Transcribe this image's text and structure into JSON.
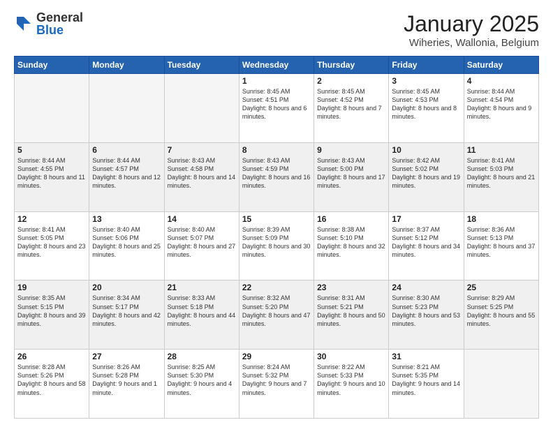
{
  "header": {
    "logo_general": "General",
    "logo_blue": "Blue",
    "title": "January 2025",
    "subtitle": "Wiheries, Wallonia, Belgium"
  },
  "days_of_week": [
    "Sunday",
    "Monday",
    "Tuesday",
    "Wednesday",
    "Thursday",
    "Friday",
    "Saturday"
  ],
  "weeks": [
    {
      "shaded": false,
      "days": [
        {
          "num": "",
          "info": ""
        },
        {
          "num": "",
          "info": ""
        },
        {
          "num": "",
          "info": ""
        },
        {
          "num": "1",
          "info": "Sunrise: 8:45 AM\nSunset: 4:51 PM\nDaylight: 8 hours and 6 minutes."
        },
        {
          "num": "2",
          "info": "Sunrise: 8:45 AM\nSunset: 4:52 PM\nDaylight: 8 hours and 7 minutes."
        },
        {
          "num": "3",
          "info": "Sunrise: 8:45 AM\nSunset: 4:53 PM\nDaylight: 8 hours and 8 minutes."
        },
        {
          "num": "4",
          "info": "Sunrise: 8:44 AM\nSunset: 4:54 PM\nDaylight: 8 hours and 9 minutes."
        }
      ]
    },
    {
      "shaded": true,
      "days": [
        {
          "num": "5",
          "info": "Sunrise: 8:44 AM\nSunset: 4:55 PM\nDaylight: 8 hours and 11 minutes."
        },
        {
          "num": "6",
          "info": "Sunrise: 8:44 AM\nSunset: 4:57 PM\nDaylight: 8 hours and 12 minutes."
        },
        {
          "num": "7",
          "info": "Sunrise: 8:43 AM\nSunset: 4:58 PM\nDaylight: 8 hours and 14 minutes."
        },
        {
          "num": "8",
          "info": "Sunrise: 8:43 AM\nSunset: 4:59 PM\nDaylight: 8 hours and 16 minutes."
        },
        {
          "num": "9",
          "info": "Sunrise: 8:43 AM\nSunset: 5:00 PM\nDaylight: 8 hours and 17 minutes."
        },
        {
          "num": "10",
          "info": "Sunrise: 8:42 AM\nSunset: 5:02 PM\nDaylight: 8 hours and 19 minutes."
        },
        {
          "num": "11",
          "info": "Sunrise: 8:41 AM\nSunset: 5:03 PM\nDaylight: 8 hours and 21 minutes."
        }
      ]
    },
    {
      "shaded": false,
      "days": [
        {
          "num": "12",
          "info": "Sunrise: 8:41 AM\nSunset: 5:05 PM\nDaylight: 8 hours and 23 minutes."
        },
        {
          "num": "13",
          "info": "Sunrise: 8:40 AM\nSunset: 5:06 PM\nDaylight: 8 hours and 25 minutes."
        },
        {
          "num": "14",
          "info": "Sunrise: 8:40 AM\nSunset: 5:07 PM\nDaylight: 8 hours and 27 minutes."
        },
        {
          "num": "15",
          "info": "Sunrise: 8:39 AM\nSunset: 5:09 PM\nDaylight: 8 hours and 30 minutes."
        },
        {
          "num": "16",
          "info": "Sunrise: 8:38 AM\nSunset: 5:10 PM\nDaylight: 8 hours and 32 minutes."
        },
        {
          "num": "17",
          "info": "Sunrise: 8:37 AM\nSunset: 5:12 PM\nDaylight: 8 hours and 34 minutes."
        },
        {
          "num": "18",
          "info": "Sunrise: 8:36 AM\nSunset: 5:13 PM\nDaylight: 8 hours and 37 minutes."
        }
      ]
    },
    {
      "shaded": true,
      "days": [
        {
          "num": "19",
          "info": "Sunrise: 8:35 AM\nSunset: 5:15 PM\nDaylight: 8 hours and 39 minutes."
        },
        {
          "num": "20",
          "info": "Sunrise: 8:34 AM\nSunset: 5:17 PM\nDaylight: 8 hours and 42 minutes."
        },
        {
          "num": "21",
          "info": "Sunrise: 8:33 AM\nSunset: 5:18 PM\nDaylight: 8 hours and 44 minutes."
        },
        {
          "num": "22",
          "info": "Sunrise: 8:32 AM\nSunset: 5:20 PM\nDaylight: 8 hours and 47 minutes."
        },
        {
          "num": "23",
          "info": "Sunrise: 8:31 AM\nSunset: 5:21 PM\nDaylight: 8 hours and 50 minutes."
        },
        {
          "num": "24",
          "info": "Sunrise: 8:30 AM\nSunset: 5:23 PM\nDaylight: 8 hours and 53 minutes."
        },
        {
          "num": "25",
          "info": "Sunrise: 8:29 AM\nSunset: 5:25 PM\nDaylight: 8 hours and 55 minutes."
        }
      ]
    },
    {
      "shaded": false,
      "days": [
        {
          "num": "26",
          "info": "Sunrise: 8:28 AM\nSunset: 5:26 PM\nDaylight: 8 hours and 58 minutes."
        },
        {
          "num": "27",
          "info": "Sunrise: 8:26 AM\nSunset: 5:28 PM\nDaylight: 9 hours and 1 minute."
        },
        {
          "num": "28",
          "info": "Sunrise: 8:25 AM\nSunset: 5:30 PM\nDaylight: 9 hours and 4 minutes."
        },
        {
          "num": "29",
          "info": "Sunrise: 8:24 AM\nSunset: 5:32 PM\nDaylight: 9 hours and 7 minutes."
        },
        {
          "num": "30",
          "info": "Sunrise: 8:22 AM\nSunset: 5:33 PM\nDaylight: 9 hours and 10 minutes."
        },
        {
          "num": "31",
          "info": "Sunrise: 8:21 AM\nSunset: 5:35 PM\nDaylight: 9 hours and 14 minutes."
        },
        {
          "num": "",
          "info": ""
        }
      ]
    }
  ]
}
